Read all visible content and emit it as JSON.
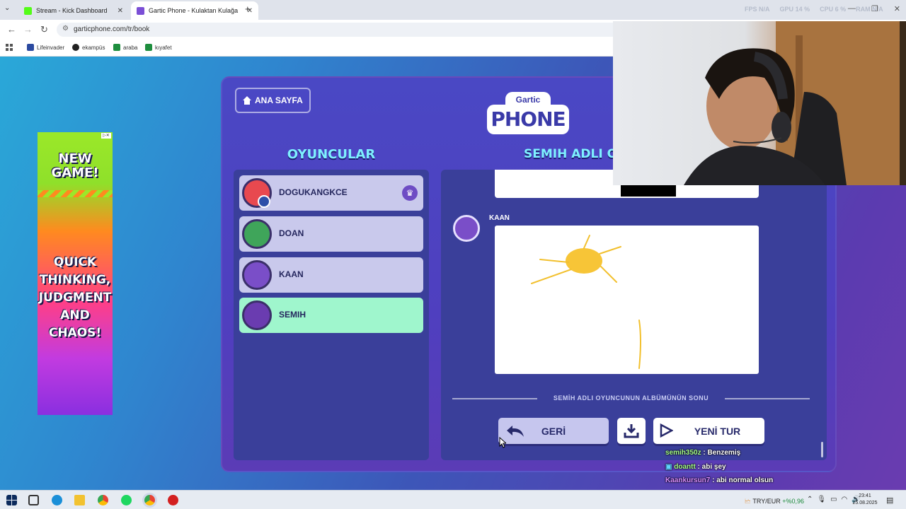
{
  "browser": {
    "tabs": [
      {
        "title": "Stream - Kick Dashboard",
        "favicon_color": "#53fc18"
      },
      {
        "title": "Gartic Phone - Kulaktan Kulağa",
        "favicon_color": "#7b4fd6"
      }
    ],
    "stats": {
      "fps_label": "FPS",
      "fps_value": "N/A",
      "gpu_label": "GPU",
      "gpu_value": "14 %",
      "cpu_label": "CPU",
      "cpu_value": "6 %",
      "ram_label": "RAM",
      "ram_value": "N/A"
    },
    "url": "garticphone.com/tr/book",
    "bookmarks": [
      {
        "label": "Lifeinvader",
        "icon_color": "#2b4aa0"
      },
      {
        "label": "ekampüs",
        "icon_color": "#222222"
      },
      {
        "label": "araba",
        "icon_color": "#1e8e3e"
      },
      {
        "label": "kıyafet",
        "icon_color": "#1e8e3e"
      }
    ]
  },
  "ad": {
    "headline": "NEW GAME!",
    "tagline": "QUICK THINKING, JUDGMENT AND CHAOS!"
  },
  "game": {
    "home_button": "ANA SAYFA",
    "logo_top": "Gartic",
    "logo_bottom": "PHONE",
    "players_title": "OYUNCULAR",
    "album_title": "SEMIH ADLI OY",
    "players": [
      {
        "name": "DOGUKANGKCE",
        "avatar_color": "#e8494f",
        "host": true,
        "active": false
      },
      {
        "name": "DOAN",
        "avatar_color": "#3fa55a",
        "host": false,
        "active": false
      },
      {
        "name": "KAAN",
        "avatar_color": "#7a4ec8",
        "host": false,
        "active": false
      },
      {
        "name": "SEMIH",
        "avatar_color": "#6a3cb0",
        "host": false,
        "active": true
      }
    ],
    "drawing_author": "KAAN",
    "album_end_text": "SEMİH ADLI OYUNCUNUN ALBÜMÜNÜN SONU",
    "back_button": "GERİ",
    "new_round_button": "YENİ TUR"
  },
  "chat": [
    {
      "user": "semih350z",
      "message": " : Benzemiş"
    },
    {
      "user": "doantt",
      "message": " : abi şey"
    },
    {
      "user": "Kaankursun7",
      "message": " : abi normal olsun"
    }
  ],
  "taskbar": {
    "fx_pair": "TRY/EUR",
    "fx_change": "+%0,96",
    "time": "23:41",
    "date": "25.08.2025"
  }
}
